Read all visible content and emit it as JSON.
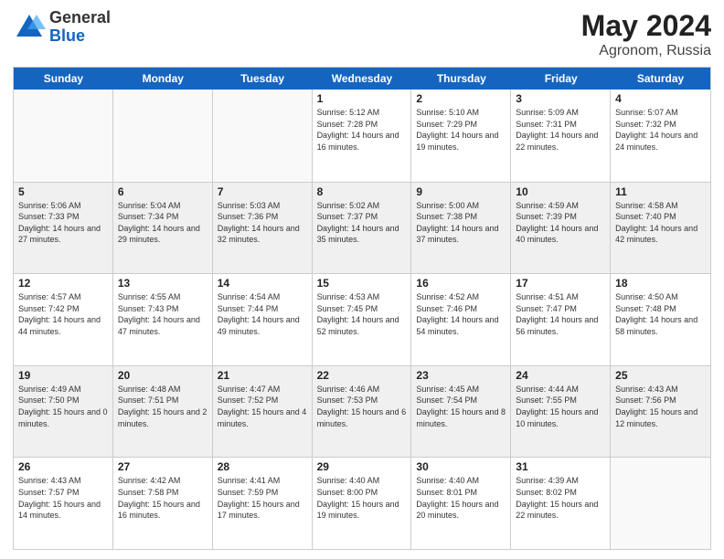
{
  "logo": {
    "general": "General",
    "blue": "Blue"
  },
  "title": {
    "month_year": "May 2024",
    "location": "Agronom, Russia"
  },
  "header_days": [
    "Sunday",
    "Monday",
    "Tuesday",
    "Wednesday",
    "Thursday",
    "Friday",
    "Saturday"
  ],
  "rows": [
    [
      {
        "date": "",
        "info": ""
      },
      {
        "date": "",
        "info": ""
      },
      {
        "date": "",
        "info": ""
      },
      {
        "date": "1",
        "info": "Sunrise: 5:12 AM\nSunset: 7:28 PM\nDaylight: 14 hours and 16 minutes."
      },
      {
        "date": "2",
        "info": "Sunrise: 5:10 AM\nSunset: 7:29 PM\nDaylight: 14 hours and 19 minutes."
      },
      {
        "date": "3",
        "info": "Sunrise: 5:09 AM\nSunset: 7:31 PM\nDaylight: 14 hours and 22 minutes."
      },
      {
        "date": "4",
        "info": "Sunrise: 5:07 AM\nSunset: 7:32 PM\nDaylight: 14 hours and 24 minutes."
      }
    ],
    [
      {
        "date": "5",
        "info": "Sunrise: 5:06 AM\nSunset: 7:33 PM\nDaylight: 14 hours and 27 minutes."
      },
      {
        "date": "6",
        "info": "Sunrise: 5:04 AM\nSunset: 7:34 PM\nDaylight: 14 hours and 29 minutes."
      },
      {
        "date": "7",
        "info": "Sunrise: 5:03 AM\nSunset: 7:36 PM\nDaylight: 14 hours and 32 minutes."
      },
      {
        "date": "8",
        "info": "Sunrise: 5:02 AM\nSunset: 7:37 PM\nDaylight: 14 hours and 35 minutes."
      },
      {
        "date": "9",
        "info": "Sunrise: 5:00 AM\nSunset: 7:38 PM\nDaylight: 14 hours and 37 minutes."
      },
      {
        "date": "10",
        "info": "Sunrise: 4:59 AM\nSunset: 7:39 PM\nDaylight: 14 hours and 40 minutes."
      },
      {
        "date": "11",
        "info": "Sunrise: 4:58 AM\nSunset: 7:40 PM\nDaylight: 14 hours and 42 minutes."
      }
    ],
    [
      {
        "date": "12",
        "info": "Sunrise: 4:57 AM\nSunset: 7:42 PM\nDaylight: 14 hours and 44 minutes."
      },
      {
        "date": "13",
        "info": "Sunrise: 4:55 AM\nSunset: 7:43 PM\nDaylight: 14 hours and 47 minutes."
      },
      {
        "date": "14",
        "info": "Sunrise: 4:54 AM\nSunset: 7:44 PM\nDaylight: 14 hours and 49 minutes."
      },
      {
        "date": "15",
        "info": "Sunrise: 4:53 AM\nSunset: 7:45 PM\nDaylight: 14 hours and 52 minutes."
      },
      {
        "date": "16",
        "info": "Sunrise: 4:52 AM\nSunset: 7:46 PM\nDaylight: 14 hours and 54 minutes."
      },
      {
        "date": "17",
        "info": "Sunrise: 4:51 AM\nSunset: 7:47 PM\nDaylight: 14 hours and 56 minutes."
      },
      {
        "date": "18",
        "info": "Sunrise: 4:50 AM\nSunset: 7:48 PM\nDaylight: 14 hours and 58 minutes."
      }
    ],
    [
      {
        "date": "19",
        "info": "Sunrise: 4:49 AM\nSunset: 7:50 PM\nDaylight: 15 hours and 0 minutes."
      },
      {
        "date": "20",
        "info": "Sunrise: 4:48 AM\nSunset: 7:51 PM\nDaylight: 15 hours and 2 minutes."
      },
      {
        "date": "21",
        "info": "Sunrise: 4:47 AM\nSunset: 7:52 PM\nDaylight: 15 hours and 4 minutes."
      },
      {
        "date": "22",
        "info": "Sunrise: 4:46 AM\nSunset: 7:53 PM\nDaylight: 15 hours and 6 minutes."
      },
      {
        "date": "23",
        "info": "Sunrise: 4:45 AM\nSunset: 7:54 PM\nDaylight: 15 hours and 8 minutes."
      },
      {
        "date": "24",
        "info": "Sunrise: 4:44 AM\nSunset: 7:55 PM\nDaylight: 15 hours and 10 minutes."
      },
      {
        "date": "25",
        "info": "Sunrise: 4:43 AM\nSunset: 7:56 PM\nDaylight: 15 hours and 12 minutes."
      }
    ],
    [
      {
        "date": "26",
        "info": "Sunrise: 4:43 AM\nSunset: 7:57 PM\nDaylight: 15 hours and 14 minutes."
      },
      {
        "date": "27",
        "info": "Sunrise: 4:42 AM\nSunset: 7:58 PM\nDaylight: 15 hours and 16 minutes."
      },
      {
        "date": "28",
        "info": "Sunrise: 4:41 AM\nSunset: 7:59 PM\nDaylight: 15 hours and 17 minutes."
      },
      {
        "date": "29",
        "info": "Sunrise: 4:40 AM\nSunset: 8:00 PM\nDaylight: 15 hours and 19 minutes."
      },
      {
        "date": "30",
        "info": "Sunrise: 4:40 AM\nSunset: 8:01 PM\nDaylight: 15 hours and 20 minutes."
      },
      {
        "date": "31",
        "info": "Sunrise: 4:39 AM\nSunset: 8:02 PM\nDaylight: 15 hours and 22 minutes."
      },
      {
        "date": "",
        "info": ""
      }
    ]
  ]
}
